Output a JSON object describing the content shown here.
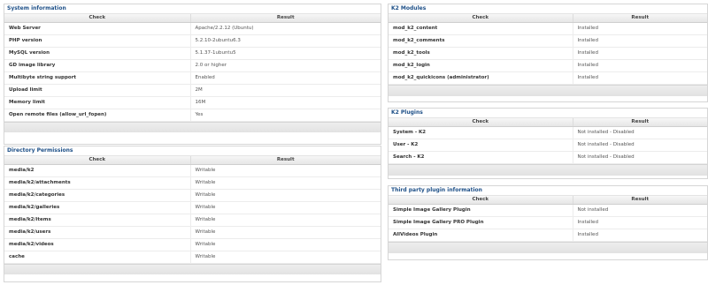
{
  "system_info": {
    "title": "System information",
    "col_check": "Check",
    "col_result": "Result",
    "rows": [
      {
        "check": "Web Server",
        "result": "Apache/2.2.12 (Ubuntu)"
      },
      {
        "check": "PHP version",
        "result": "5.2.10-2ubuntu6.3"
      },
      {
        "check": "MySQL version",
        "result": "5.1.37-1ubuntu5"
      },
      {
        "check": "GD image library",
        "result": "2.0 or higher"
      },
      {
        "check": "Multibyte string support",
        "result": "Enabled"
      },
      {
        "check": "Upload limit",
        "result": "2M"
      },
      {
        "check": "Memory limit",
        "result": "16M"
      },
      {
        "check": "Open remote files (allow_url_fopen)",
        "result": "Yes"
      }
    ]
  },
  "directory_permissions": {
    "title": "Directory Permissions",
    "col_check": "Check",
    "col_result": "Result",
    "rows": [
      {
        "check": "media/k2",
        "result": "Writable"
      },
      {
        "check": "media/k2/attachments",
        "result": "Writable"
      },
      {
        "check": "media/k2/categories",
        "result": "Writable"
      },
      {
        "check": "media/k2/galleries",
        "result": "Writable"
      },
      {
        "check": "media/k2/items",
        "result": "Writable"
      },
      {
        "check": "media/k2/users",
        "result": "Writable"
      },
      {
        "check": "media/k2/videos",
        "result": "Writable"
      },
      {
        "check": "cache",
        "result": "Writable"
      }
    ]
  },
  "k2_modules": {
    "title": "K2 Modules",
    "col_check": "Check",
    "col_result": "Result",
    "rows": [
      {
        "check": "mod_k2_content",
        "result": "Installed"
      },
      {
        "check": "mod_k2_comments",
        "result": "Installed"
      },
      {
        "check": "mod_k2_tools",
        "result": "Installed"
      },
      {
        "check": "mod_k2_login",
        "result": "Installed"
      },
      {
        "check": "mod_k2_quickicons (administrator)",
        "result": "Installed"
      }
    ]
  },
  "k2_plugins": {
    "title": "K2 Plugins",
    "col_check": "Check",
    "col_result": "Result",
    "rows": [
      {
        "check": "System - K2",
        "result": "Not installed - Disabled"
      },
      {
        "check": "User - K2",
        "result": "Not installed - Disabled"
      },
      {
        "check": "Search - K2",
        "result": "Not installed - Disabled"
      }
    ]
  },
  "third_party": {
    "title": "Third party plugin information",
    "col_check": "Check",
    "col_result": "Result",
    "rows": [
      {
        "check": "Simple Image Gallery Plugin",
        "result": "Not installed"
      },
      {
        "check": "Simple Image Gallery PRO Plugin",
        "result": "Installed"
      },
      {
        "check": "AllVideos Plugin",
        "result": "Installed"
      }
    ]
  }
}
